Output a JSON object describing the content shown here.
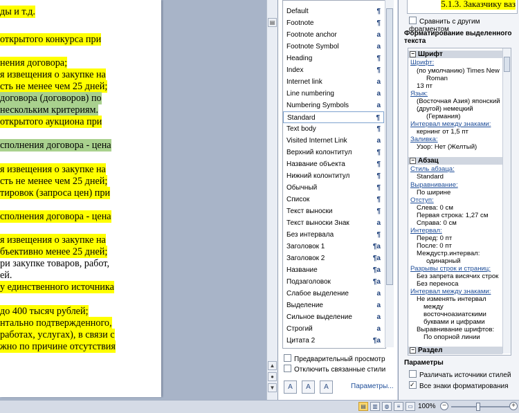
{
  "document": {
    "lines": [
      {
        "text": "ды и т.д.",
        "hl": "y"
      },
      {
        "text": "открытого конкурса при",
        "hl": "y"
      },
      {
        "text": "нения договора;",
        "hl": "y"
      },
      {
        "text": "я извещения о закупке на",
        "hl": "y"
      },
      {
        "text": "сть не менее чем 25 дней;",
        "hl": "y"
      },
      {
        "text": "договора (договоров) по",
        "hl": "g"
      },
      {
        "text": "нескольким критериям.",
        "hl": "g"
      },
      {
        "text": "открытого аукциона при",
        "hl": "y"
      },
      {
        "text": "сполнения договора - цена",
        "hl": "g"
      },
      {
        "text": "я извещения о закупке на",
        "hl": "y"
      },
      {
        "text": "сть не менее чем 25 дней;",
        "hl": "y"
      },
      {
        "text": "тировок (запроса цен) при",
        "hl": "y"
      },
      {
        "text": "сполнения договора - цена",
        "hl": "y"
      },
      {
        "text": "я извещения о закупке на",
        "hl": "y"
      },
      {
        "text": "бъективно менее 25 дней;",
        "hl": "y"
      },
      {
        "text": "ри закупке товаров, работ,",
        "hl": ""
      },
      {
        "text": "ей.",
        "hl": ""
      },
      {
        "text": "у единственного источника",
        "hl": "y"
      },
      {
        "text": "до 400 тысяч рублей;",
        "hl": "y"
      },
      {
        "text": "нтально подтвержденного,",
        "hl": "y"
      },
      {
        "text": "работах, услугах), в связи с",
        "hl": "y"
      },
      {
        "text": "жно по причине отсутствия",
        "hl": "y"
      }
    ]
  },
  "styles_pane": {
    "items": [
      {
        "label": "Default",
        "mark": "¶"
      },
      {
        "label": "Footnote",
        "mark": "¶"
      },
      {
        "label": "Footnote anchor",
        "mark": "a"
      },
      {
        "label": "Footnote Symbol",
        "mark": "a"
      },
      {
        "label": "Heading",
        "mark": "¶"
      },
      {
        "label": "Index",
        "mark": "¶"
      },
      {
        "label": "Internet link",
        "mark": "a"
      },
      {
        "label": "Line numbering",
        "mark": "a"
      },
      {
        "label": "Numbering Symbols",
        "mark": "a"
      },
      {
        "label": "Standard",
        "mark": "¶"
      },
      {
        "label": "Text body",
        "mark": "¶"
      },
      {
        "label": "Visited Internet Link",
        "mark": "a"
      },
      {
        "label": "Верхний колонтитул",
        "mark": "¶"
      },
      {
        "label": "Название объекта",
        "mark": "¶"
      },
      {
        "label": "Нижний колонтитул",
        "mark": "¶"
      },
      {
        "label": "Обычный",
        "mark": "¶"
      },
      {
        "label": "Список",
        "mark": "¶"
      },
      {
        "label": "Текст выноски",
        "mark": "¶"
      },
      {
        "label": "Текст выноски Знак",
        "mark": "a"
      },
      {
        "label": "Без интервала",
        "mark": "¶"
      },
      {
        "label": "Заголовок 1",
        "mark": "¶a"
      },
      {
        "label": "Заголовок 2",
        "mark": "¶a"
      },
      {
        "label": "Название",
        "mark": "¶a"
      },
      {
        "label": "Подзаголовок",
        "mark": "¶a"
      },
      {
        "label": "Слабое выделение",
        "mark": "a"
      },
      {
        "label": "Выделение",
        "mark": "a"
      },
      {
        "label": "Сильное выделение",
        "mark": "a"
      },
      {
        "label": "Строгий",
        "mark": "a"
      },
      {
        "label": "Цитата 2",
        "mark": "¶a"
      }
    ],
    "selected": "Standard",
    "preview_label": "Предварительный просмотр",
    "disable_linked_label": "Отключить связанные стили",
    "params_link": "Параметры..."
  },
  "reveal": {
    "preview_text": "5.1.3. Заказчику ваз",
    "compare_label": "Сравнить с другим фрагментом",
    "header": "Форматирование выделенного текста",
    "font_section": "Шрифт",
    "font_link": "Шрифт:",
    "font_v1": "(по умолчанию) Times New",
    "font_v2": "Roman",
    "font_v3": "13 пт",
    "lang_link": "Язык:",
    "lang_v1": "(Восточная Азия) японский",
    "lang_v2": "(другой) немецкий",
    "lang_v3": "(Германия)",
    "spacing_link": "Интервал между знаками:",
    "spacing_v1": "кернинг от 1,5 пт",
    "fill_link": "Заливка:",
    "fill_v1": "Узор: Нет (Желтый)",
    "para_section": "Абзац",
    "pstyle_link": "Стиль абзаца:",
    "pstyle_v": "Standard",
    "align_link": "Выравнивание:",
    "align_v": "По ширине",
    "indent_link": "Отступ:",
    "indent_left": "Слева:  0 см",
    "indent_first": "Первая строка:  1,27 см",
    "indent_right": "Справа:  0 см",
    "interval_link": "Интервал:",
    "before": "Перед:  0 пт",
    "after": "После:  0 пт",
    "line_int1": "Междустр.интервал:",
    "line_int2": "одинарный",
    "breaks_link": "Разрывы строк и страниц:",
    "breaks_v1": "Без запрета висячих строк",
    "breaks_v2": "Без переноса",
    "charspace_link": "Интервал между знаками:",
    "cs1": "Не изменять интервал",
    "cs2": "между",
    "cs3": "восточноазиатскими",
    "cs4": "буквами и цифрами",
    "cs5": "Выравнивание шрифтов:",
    "cs6": "По опорной линии",
    "section3": "Раздел",
    "params_title": "Параметры",
    "distinguish_label": "Различать источники стилей",
    "all_marks_label": "Все знаки форматирования"
  },
  "status": {
    "zoom": "100%"
  }
}
